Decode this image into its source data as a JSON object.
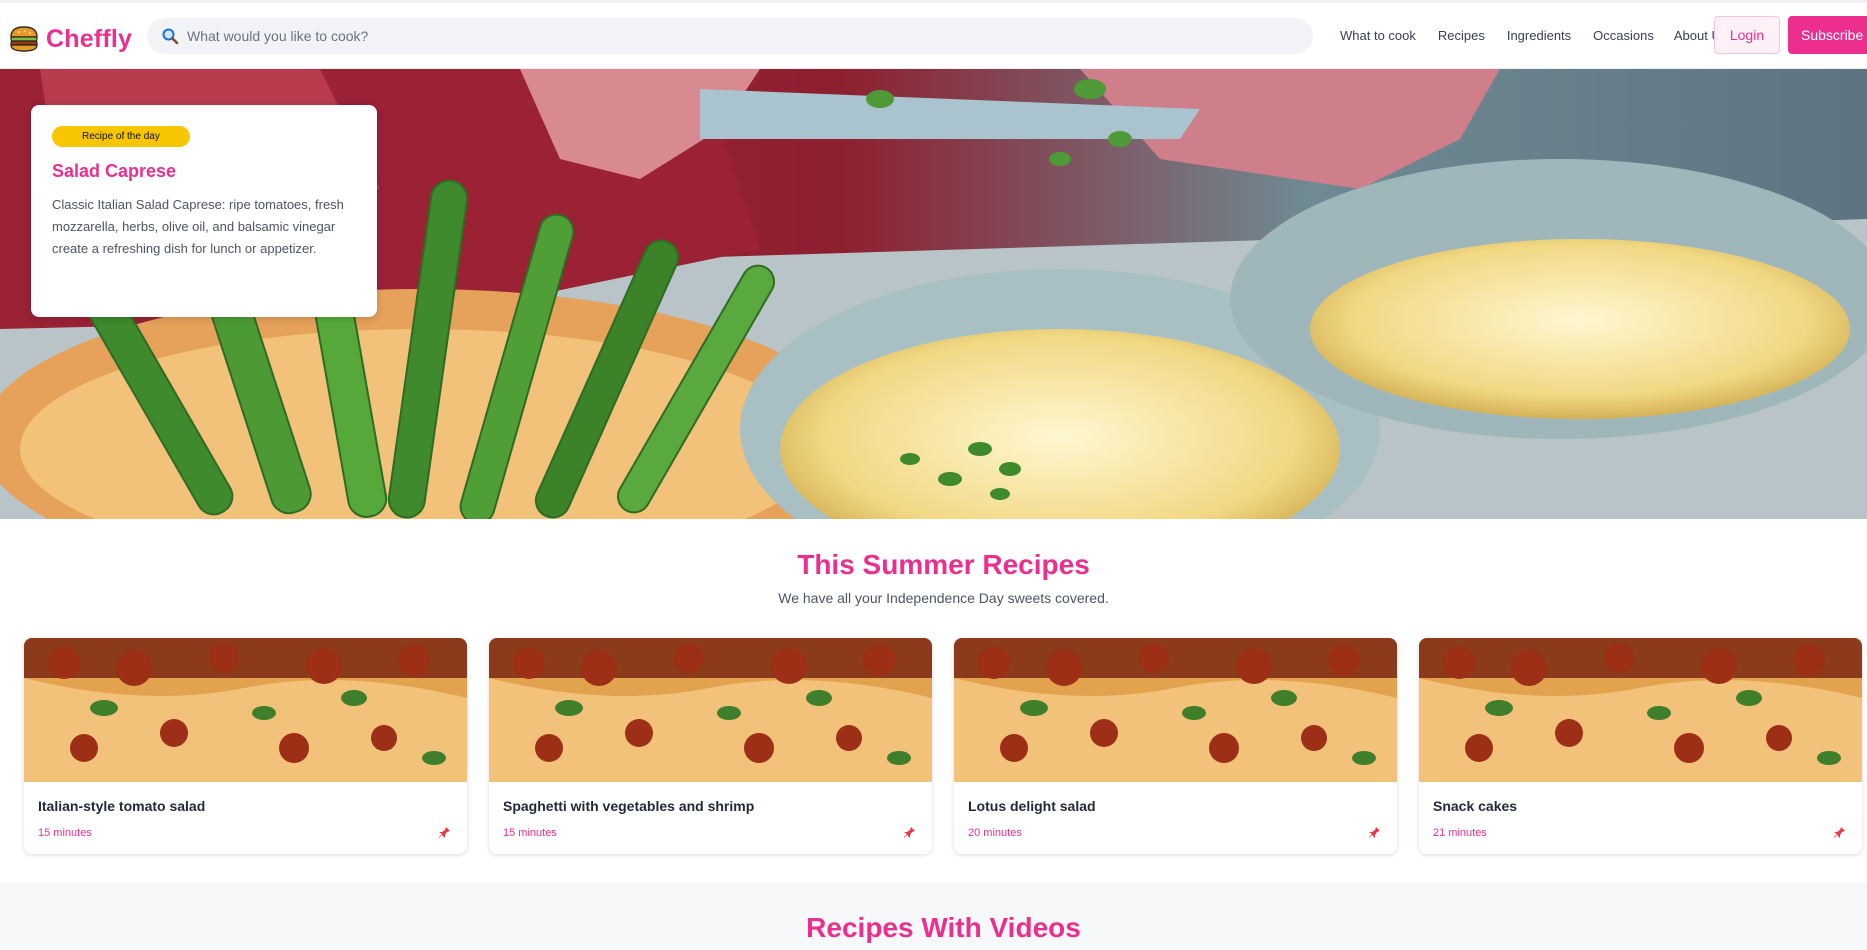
{
  "brand": {
    "name": "Cheffly",
    "accent": "#ec2f8f",
    "logo_icon": "burger-icon"
  },
  "search": {
    "placeholder": "What would you like to cook?",
    "value": ""
  },
  "nav": {
    "items": [
      "What to cook",
      "Recipes",
      "Ingredients",
      "Occasions",
      "About Us"
    ]
  },
  "auth": {
    "login_label": "Login",
    "subscribe_label": "Subscribe"
  },
  "hero": {
    "badge": "Recipe of the day",
    "title": "Salad Caprese",
    "description": "Classic Italian Salad Caprese: ripe tomatoes, fresh mozzarella, herbs, olive oil, and balsamic vinegar create a refreshing dish for lunch or appetizer."
  },
  "summer": {
    "title": "This Summer Recipes",
    "subtitle": "We have all your Independence Day sweets covered.",
    "recipes": [
      {
        "title": "Italian-style tomato salad",
        "time": "15 minutes"
      },
      {
        "title": "Spaghetti with vegetables and shrimp",
        "time": "15 minutes"
      },
      {
        "title": "Lotus delight salad",
        "time": "20 minutes"
      },
      {
        "title": "Snack cakes",
        "time": "21 minutes"
      }
    ]
  },
  "videos": {
    "title": "Recipes With Videos"
  }
}
